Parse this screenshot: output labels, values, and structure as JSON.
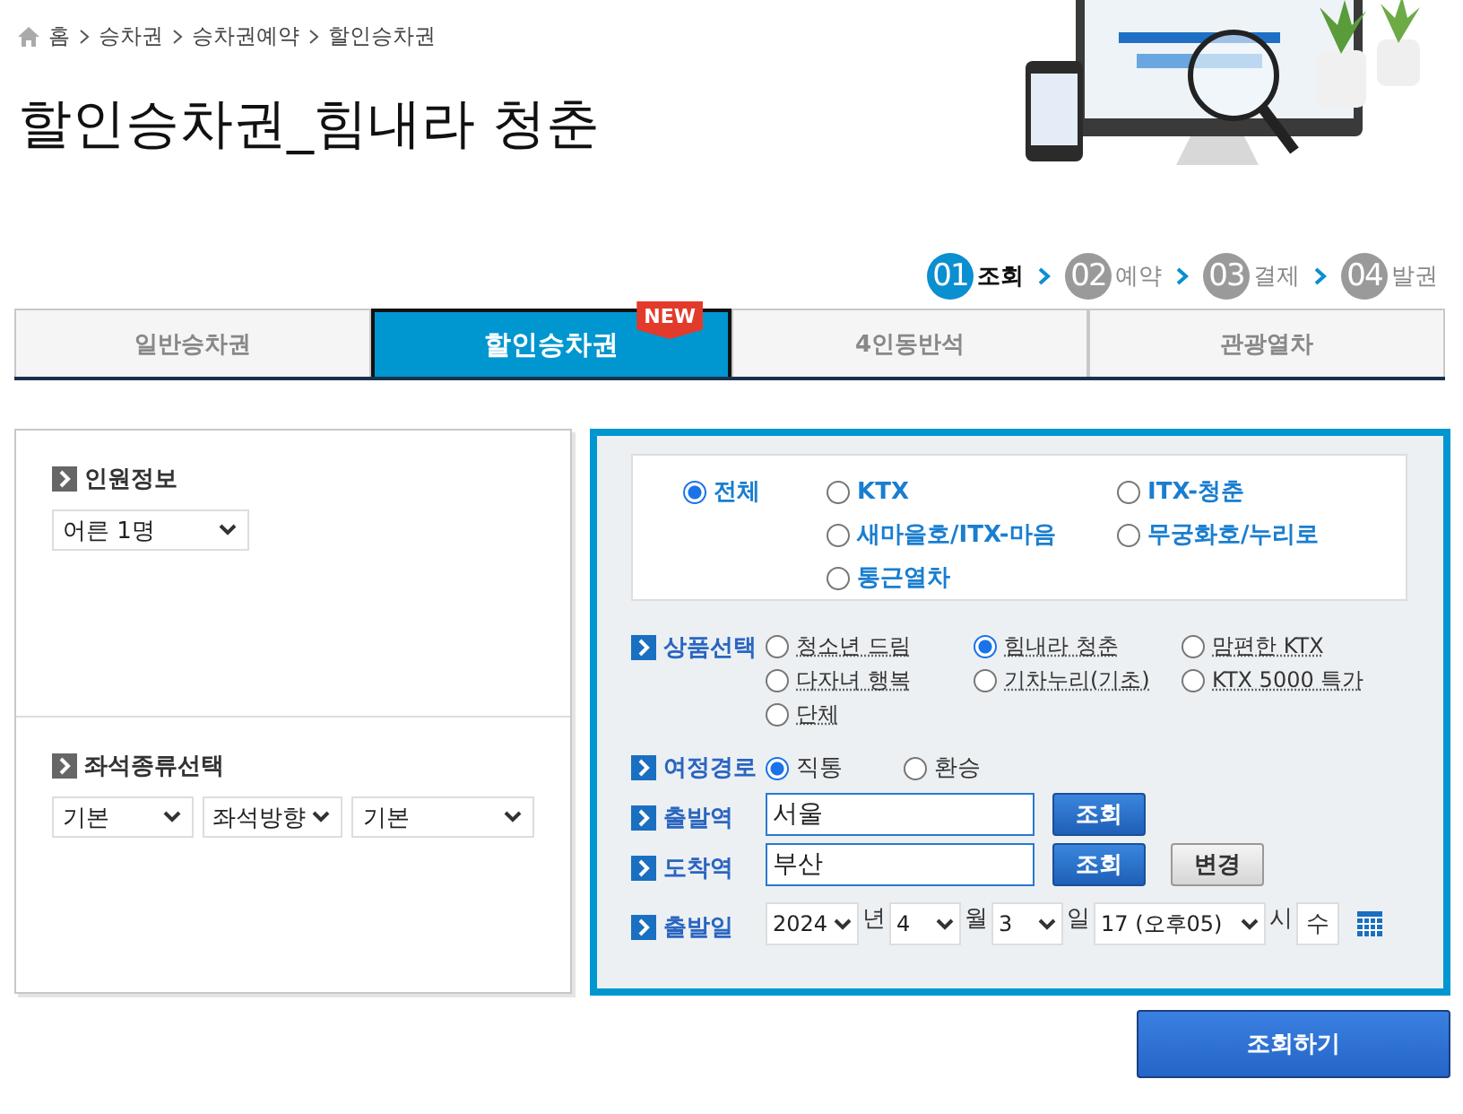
{
  "breadcrumb": [
    {
      "label": "홈"
    },
    {
      "label": "승차권"
    },
    {
      "label": "승차권예약"
    },
    {
      "label": "할인승차권"
    }
  ],
  "title": "할인승차권_힘내라 청춘",
  "steps": [
    {
      "number": "01",
      "label": "조회",
      "selected": true
    },
    {
      "number": "02",
      "label": "예약",
      "selected": false
    },
    {
      "number": "03",
      "label": "결제",
      "selected": false
    },
    {
      "number": "04",
      "label": "발권",
      "selected": false
    }
  ],
  "tabs": [
    {
      "label": "일반승차권",
      "selected": false
    },
    {
      "label": "할인승차권",
      "selected": true,
      "badge": "NEW"
    },
    {
      "label": "4인동반석",
      "selected": false
    },
    {
      "label": "관광열차",
      "selected": false
    }
  ],
  "passenger": {
    "heading": "인원정보",
    "select": "어른 1명"
  },
  "seat": {
    "heading": "좌석종류선택",
    "selects": [
      "기본",
      "좌석방향",
      "기본"
    ]
  },
  "train_types": [
    {
      "label": "전체",
      "selected": true
    },
    {
      "label": "KTX",
      "selected": false
    },
    {
      "label": "ITX-청춘",
      "selected": false
    },
    {
      "label": "새마을호/ITX-마음",
      "selected": false
    },
    {
      "label": "무궁화호/누리로",
      "selected": false
    },
    {
      "label": "통근열차",
      "selected": false
    }
  ],
  "products": {
    "label": "상품선택",
    "options": [
      {
        "label": "청소년 드림",
        "selected": false
      },
      {
        "label": "힘내라 청춘",
        "selected": true
      },
      {
        "label": "맘편한 KTX",
        "selected": false
      },
      {
        "label": "다자녀 행복",
        "selected": false
      },
      {
        "label": "기차누리(기초)",
        "selected": false
      },
      {
        "label": "KTX 5000 특가",
        "selected": false
      },
      {
        "label": "단체",
        "selected": false
      }
    ]
  },
  "route": {
    "label": "여정경로",
    "options": [
      {
        "label": "직통",
        "selected": true
      },
      {
        "label": "환승",
        "selected": false
      }
    ]
  },
  "departure": {
    "label": "출발역",
    "value": "서울",
    "button": "조회"
  },
  "arrival": {
    "label": "도착역",
    "value": "부산",
    "button": "조회",
    "swap_button": "변경"
  },
  "date": {
    "label": "출발일",
    "year": "2024",
    "year_unit": "년",
    "month": "4",
    "month_unit": "월",
    "day": "3",
    "day_unit": "일",
    "hour": "17 (오후05)",
    "hour_unit": "시",
    "weekday": "수"
  },
  "submit": "조회하기"
}
